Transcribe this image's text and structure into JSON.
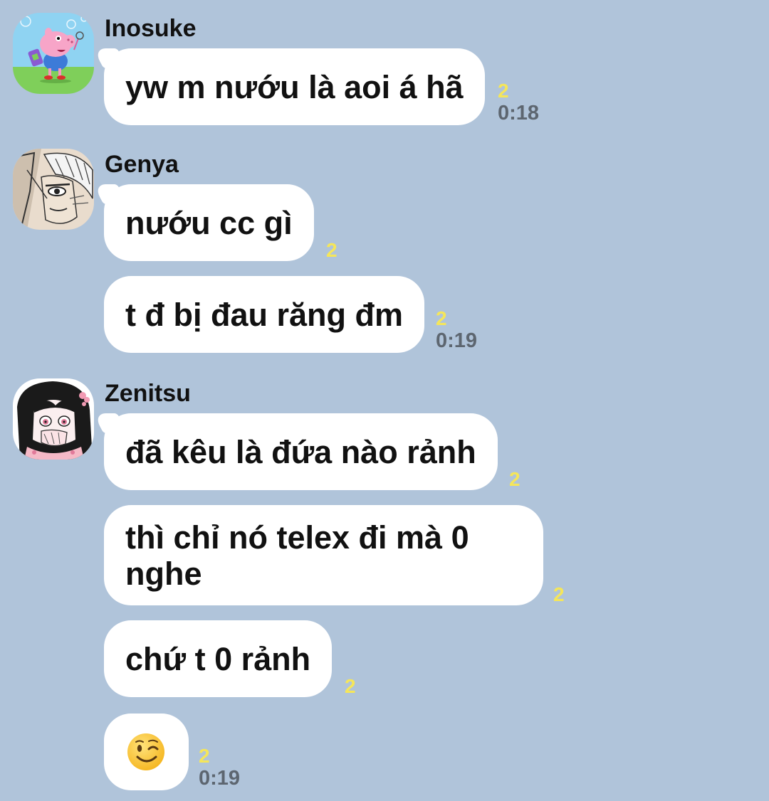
{
  "colors": {
    "background": "#b0c4da",
    "bubble": "#ffffff",
    "read_count": "#f5e65a",
    "timestamp": "#5d6670"
  },
  "groups": [
    {
      "sender": "Inosuke",
      "avatar_icon": "peppa-pig-avatar-icon",
      "messages": [
        {
          "text": "yw m nướu là aoi á hã",
          "read": "2",
          "time": "0:18"
        }
      ]
    },
    {
      "sender": "Genya",
      "avatar_icon": "manga-character-avatar-icon",
      "messages": [
        {
          "text": "nướu cc gì",
          "read": "2",
          "time": ""
        },
        {
          "text": "t đ bị đau răng đm",
          "read": "2",
          "time": "0:19"
        }
      ]
    },
    {
      "sender": "Zenitsu",
      "avatar_icon": "anime-girl-avatar-icon",
      "messages": [
        {
          "text": "đã kêu là đứa nào rảnh",
          "read": "2",
          "time": ""
        },
        {
          "text": "thì chỉ nó telex đi mà 0\nnghe",
          "read": "2",
          "time": ""
        },
        {
          "text": "chứ t 0 rảnh",
          "read": "2",
          "time": ""
        },
        {
          "emoji": "winking-face-emoji-icon",
          "read": "2",
          "time": "0:19"
        }
      ]
    }
  ]
}
